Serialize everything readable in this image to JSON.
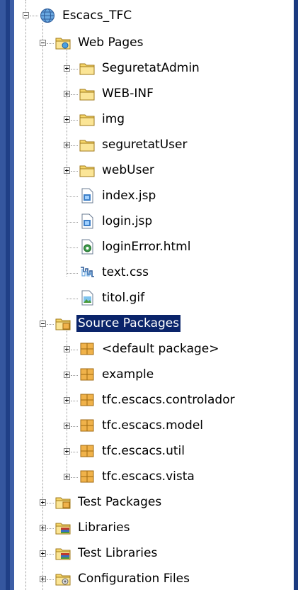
{
  "tree": {
    "project": {
      "label": "Escacs_TFC",
      "icon": "globe-icon"
    },
    "web_pages": {
      "label": "Web Pages",
      "children": [
        {
          "label": "SeguretatAdmin",
          "icon": "folder-icon"
        },
        {
          "label": "WEB-INF",
          "icon": "folder-icon"
        },
        {
          "label": "img",
          "icon": "folder-icon"
        },
        {
          "label": "seguretatUser",
          "icon": "folder-icon"
        },
        {
          "label": "webUser",
          "icon": "folder-icon"
        },
        {
          "label": "index.jsp",
          "icon": "jsp-file-icon"
        },
        {
          "label": "login.jsp",
          "icon": "jsp-file-icon"
        },
        {
          "label": "loginError.html",
          "icon": "html-file-icon"
        },
        {
          "label": "text.css",
          "icon": "css-file-icon"
        },
        {
          "label": "titol.gif",
          "icon": "image-file-icon"
        }
      ]
    },
    "source_packages": {
      "label": "Source Packages",
      "children": [
        {
          "label": "<default package>",
          "icon": "package-icon"
        },
        {
          "label": "example",
          "icon": "package-icon"
        },
        {
          "label": "tfc.escacs.controlador",
          "icon": "package-icon"
        },
        {
          "label": "tfc.escacs.model",
          "icon": "package-icon"
        },
        {
          "label": "tfc.escacs.util",
          "icon": "package-icon"
        },
        {
          "label": "tfc.escacs.vista",
          "icon": "package-icon"
        }
      ]
    },
    "bottom_nodes": [
      {
        "label": "Test Packages",
        "icon": "test-packages-icon"
      },
      {
        "label": "Libraries",
        "icon": "libraries-icon"
      },
      {
        "label": "Test Libraries",
        "icon": "test-libraries-icon"
      },
      {
        "label": "Configuration Files",
        "icon": "config-files-icon"
      }
    ]
  },
  "colors": {
    "background": "#1d3a7a",
    "selection": "#0a246a",
    "folder": "#f6d66a",
    "package": "#f0b24a"
  }
}
